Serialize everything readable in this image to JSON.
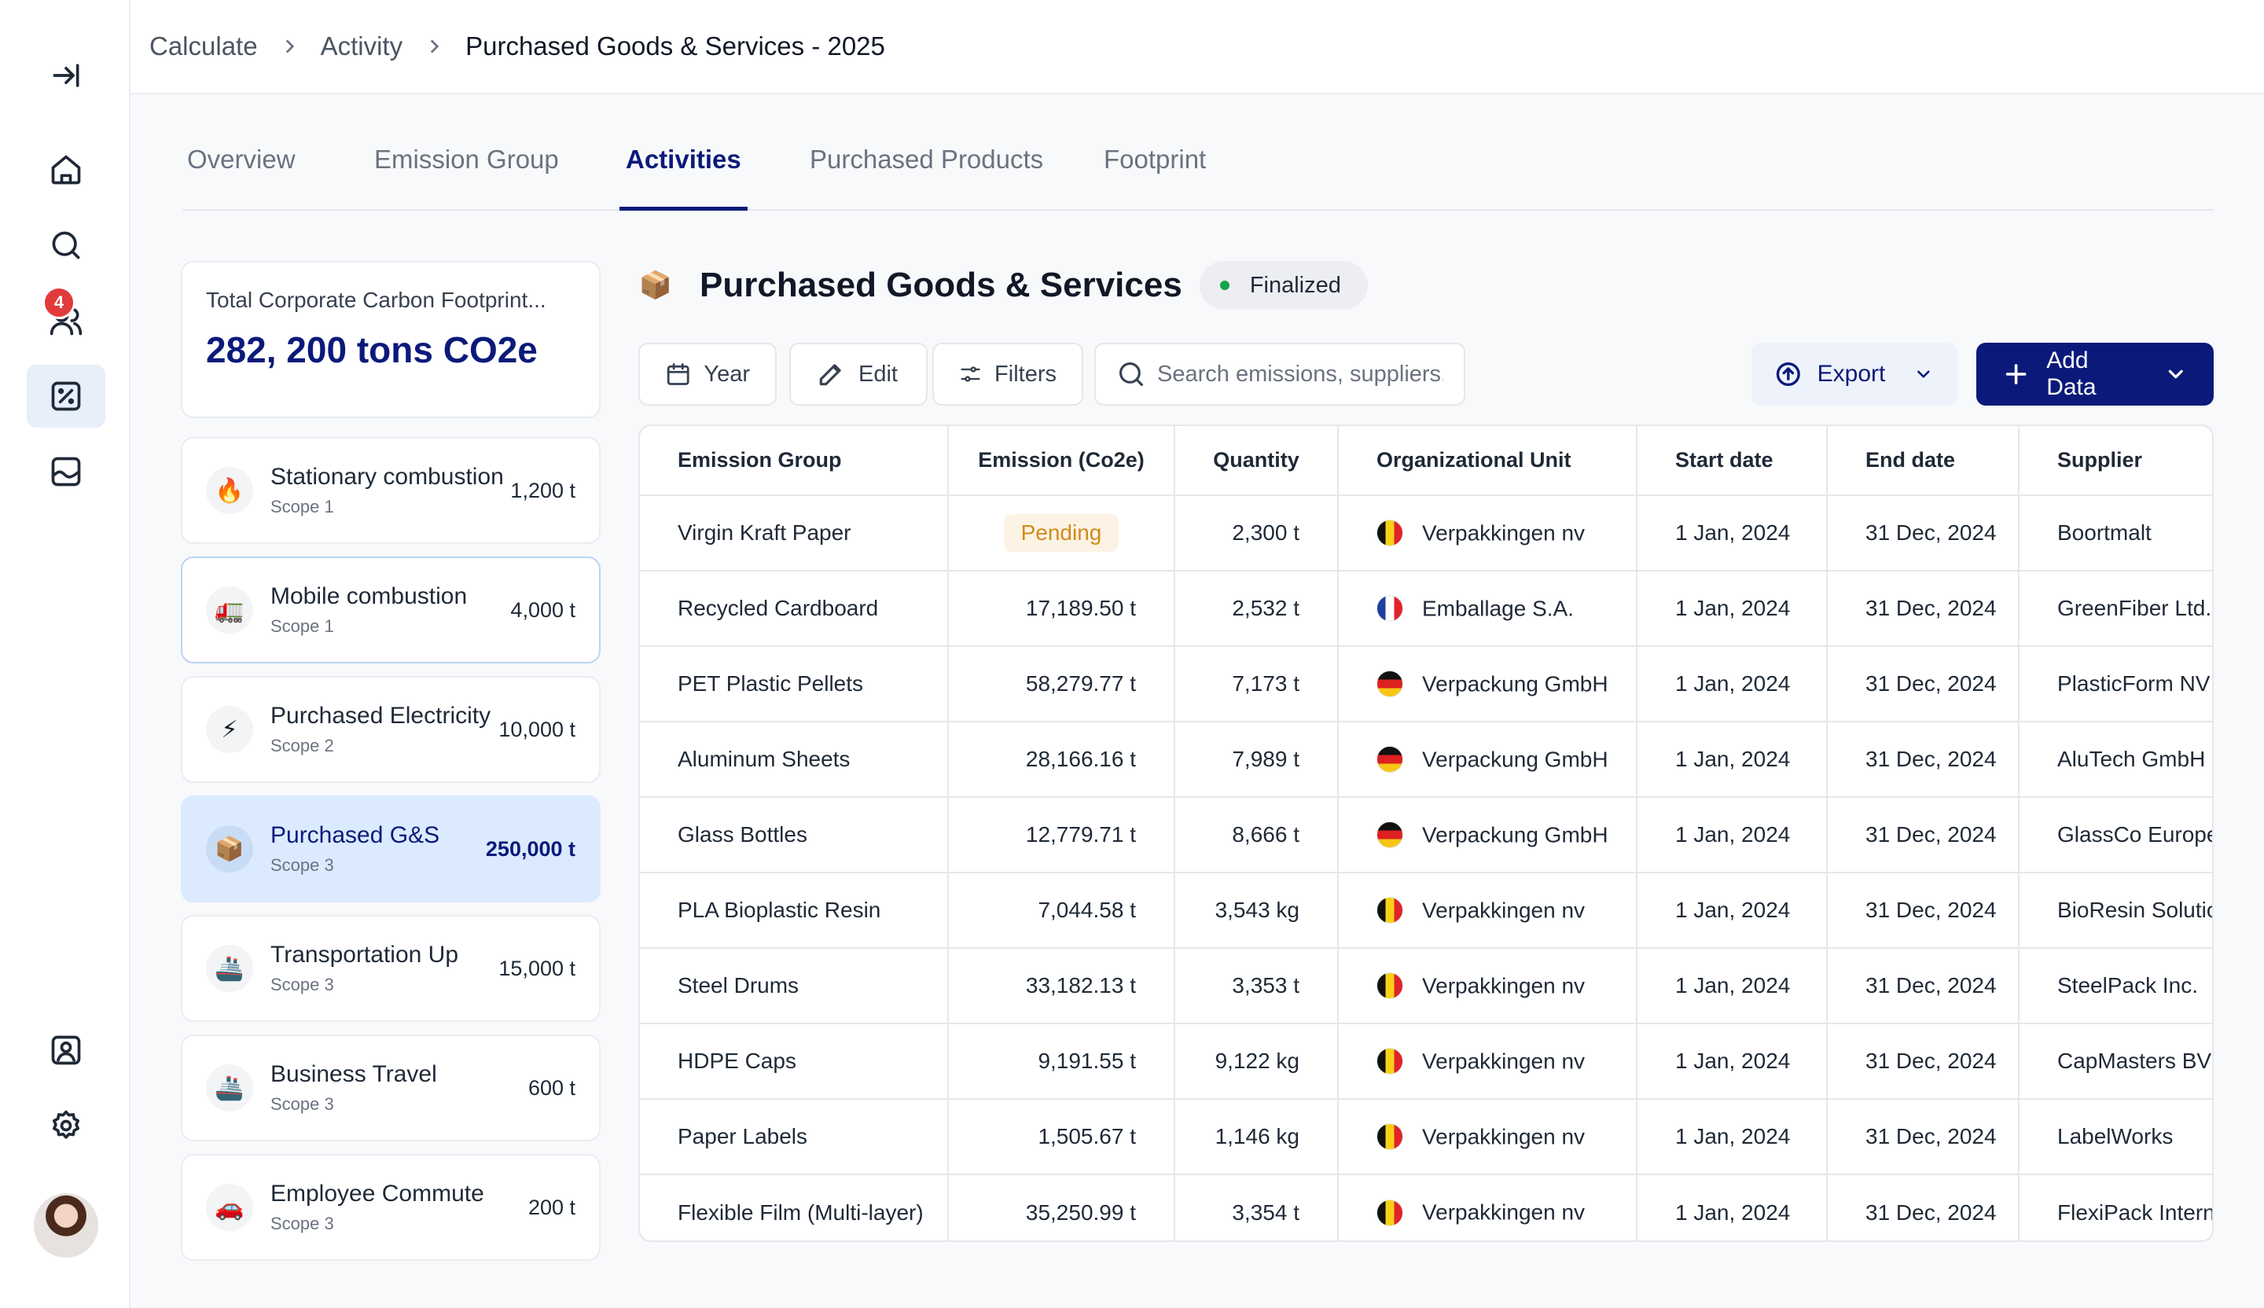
{
  "breadcrumb": [
    "Calculate",
    "Activity",
    "Purchased Goods & Services - 2025"
  ],
  "nav": {
    "notification_count": "4",
    "active_item": "calculator"
  },
  "tabs": [
    {
      "label": "Overview"
    },
    {
      "label": "Emission Group"
    },
    {
      "label": "Activities",
      "active": true
    },
    {
      "label": "Purchased Products"
    },
    {
      "label": "Footprint"
    }
  ],
  "total": {
    "label": "Total Corporate Carbon Footprint...",
    "value": "282, 200 tons CO2e"
  },
  "categories": [
    {
      "name": "Stationary combustion",
      "scope": "Scope 1",
      "value": "1,200 t",
      "icon": "fire-icon",
      "glyph": "🔥"
    },
    {
      "name": "Mobile combustion",
      "scope": "Scope 1",
      "value": "4,000 t",
      "icon": "truck-icon",
      "glyph": "🚛"
    },
    {
      "name": "Purchased Electricity",
      "scope": "Scope 2",
      "value": "10,000 t",
      "icon": "lightning-icon",
      "glyph": "⚡"
    },
    {
      "name": "Purchased G&S",
      "scope": "Scope 3",
      "value": "250,000 t",
      "icon": "package-icon",
      "glyph": "📦"
    },
    {
      "name": "Transportation Up",
      "scope": "Scope 3",
      "value": "15,000 t",
      "icon": "ship-icon",
      "glyph": "🚢"
    },
    {
      "name": "Business Travel",
      "scope": "Scope 3",
      "value": "600 t",
      "icon": "ship-icon",
      "glyph": "🚢"
    },
    {
      "name": "Employee Commute",
      "scope": "Scope 3",
      "value": "200 t",
      "icon": "car-icon",
      "glyph": "🚗"
    }
  ],
  "section": {
    "title": "Purchased Goods & Services",
    "icon_glyph": "📦",
    "status": "Finalized",
    "status_color": "#16a34a"
  },
  "toolbar": {
    "year_label": "Year",
    "edit_label": "Edit",
    "filters_label": "Filters",
    "search_placeholder": "Search emissions, suppliers...",
    "export_label": "Export",
    "add_label": "Add Data"
  },
  "colors": {
    "brand": "#0b1a7a",
    "selected_bg": "#dbeafe",
    "pending_text": "#d28a1c",
    "badge": "#e23b3b"
  },
  "table": {
    "columns": [
      "Emission Group",
      "Emission (Co2e)",
      "Quantity",
      "Organizational Unit",
      "Start date",
      "End date",
      "Supplier"
    ],
    "rows": [
      {
        "group": "Virgin Kraft Paper",
        "emission": "Pending",
        "pending": true,
        "quantity": "2,300 t",
        "flag": "be",
        "org": "Verpakkingen nv",
        "start": "1 Jan, 2024",
        "end": "31 Dec, 2024",
        "supplier": "Boortmalt"
      },
      {
        "group": "Recycled Cardboard",
        "emission": "17,189.50 t",
        "quantity": "2,532 t",
        "flag": "fr",
        "org": "Emballage S.A.",
        "start": "1 Jan, 2024",
        "end": "31 Dec, 2024",
        "supplier": "GreenFiber Ltd."
      },
      {
        "group": "PET Plastic Pellets",
        "emission": "58,279.77 t",
        "quantity": "7,173 t",
        "flag": "de",
        "org": "Verpackung GmbH",
        "start": "1 Jan, 2024",
        "end": "31 Dec, 2024",
        "supplier": "PlasticForm NV"
      },
      {
        "group": "Aluminum Sheets",
        "emission": "28,166.16 t",
        "quantity": "7,989 t",
        "flag": "de",
        "org": "Verpackung GmbH",
        "start": "1 Jan, 2024",
        "end": "31 Dec, 2024",
        "supplier": "AluTech GmbH"
      },
      {
        "group": "Glass Bottles",
        "emission": "12,779.71 t",
        "quantity": "8,666 t",
        "flag": "de",
        "org": "Verpackung GmbH",
        "start": "1 Jan, 2024",
        "end": "31 Dec, 2024",
        "supplier": "GlassCo Europe"
      },
      {
        "group": "PLA Bioplastic Resin",
        "emission": "7,044.58 t",
        "quantity": "3,543 kg",
        "flag": "be",
        "org": "Verpakkingen nv",
        "start": "1 Jan, 2024",
        "end": "31 Dec, 2024",
        "supplier": "BioResin Solutions"
      },
      {
        "group": "Steel Drums",
        "emission": "33,182.13 t",
        "quantity": "3,353 t",
        "flag": "be",
        "org": "Verpakkingen nv",
        "start": "1 Jan, 2024",
        "end": "31 Dec, 2024",
        "supplier": "SteelPack Inc."
      },
      {
        "group": "HDPE Caps",
        "emission": "9,191.55 t",
        "quantity": "9,122 kg",
        "flag": "be",
        "org": "Verpakkingen nv",
        "start": "1 Jan, 2024",
        "end": "31 Dec, 2024",
        "supplier": "CapMasters BV"
      },
      {
        "group": "Paper Labels",
        "emission": "1,505.67 t",
        "quantity": "1,146 kg",
        "flag": "be",
        "org": "Verpakkingen nv",
        "start": "1 Jan, 2024",
        "end": "31 Dec, 2024",
        "supplier": "LabelWorks"
      },
      {
        "group": "Flexible Film (Multi-layer)",
        "emission": "35,250.99 t",
        "quantity": "3,354 t",
        "flag": "be",
        "org": "Verpakkingen nv",
        "start": "1 Jan, 2024",
        "end": "31 Dec, 2024",
        "supplier": "FlexiPack International"
      }
    ]
  }
}
